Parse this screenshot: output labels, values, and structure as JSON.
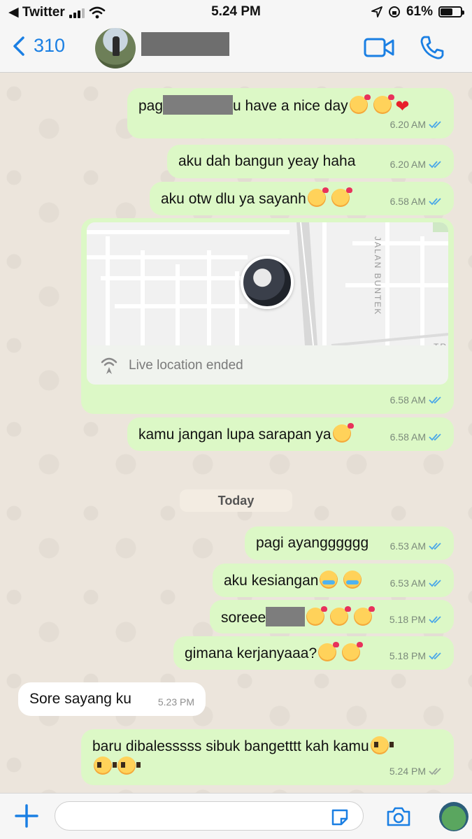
{
  "status_bar": {
    "back_app": "◀ Twitter",
    "time": "5.24 PM",
    "battery_percent": "61%",
    "battery_level": 0.61
  },
  "header": {
    "back_count": "310",
    "contact_name": "▬▬▬▬▬"
  },
  "messages": [
    {
      "text_before": "pag",
      "text_after": "u have a nice day",
      "time": "6.20 AM"
    },
    {
      "text": "aku dah bangun yeay haha",
      "time": "6.20 AM"
    },
    {
      "text": "aku otw dlu ya sayanh",
      "time": "6.58 AM"
    },
    {
      "live_label": "Live location ended",
      "map_street": "JALAN BUNTEK",
      "map_corner": "TRA",
      "time": "6.58 AM"
    },
    {
      "text": "kamu jangan lupa sarapan ya",
      "time": "6.58 AM"
    },
    {
      "text": "pagi ayangggggg",
      "time": "6.53 AM"
    },
    {
      "text": "aku kesiangan",
      "time": "6.53 AM"
    },
    {
      "text": "soreee",
      "time": "5.18 PM"
    },
    {
      "text": "gimana kerjanyaaa?",
      "time": "5.18 PM"
    },
    {
      "text": "Sore sayang ku",
      "time": "5.23 PM"
    },
    {
      "text": "baru dibalesssss sibuk bangetttt kah kamu",
      "time": "5.24 PM"
    }
  ],
  "day_separator": "Today",
  "input": {
    "placeholder": ""
  },
  "colors": {
    "accent": "#1a7fe3",
    "outgoing": "#dcf8c6",
    "incoming": "#ffffff",
    "read_tick": "#4aa7e8"
  }
}
